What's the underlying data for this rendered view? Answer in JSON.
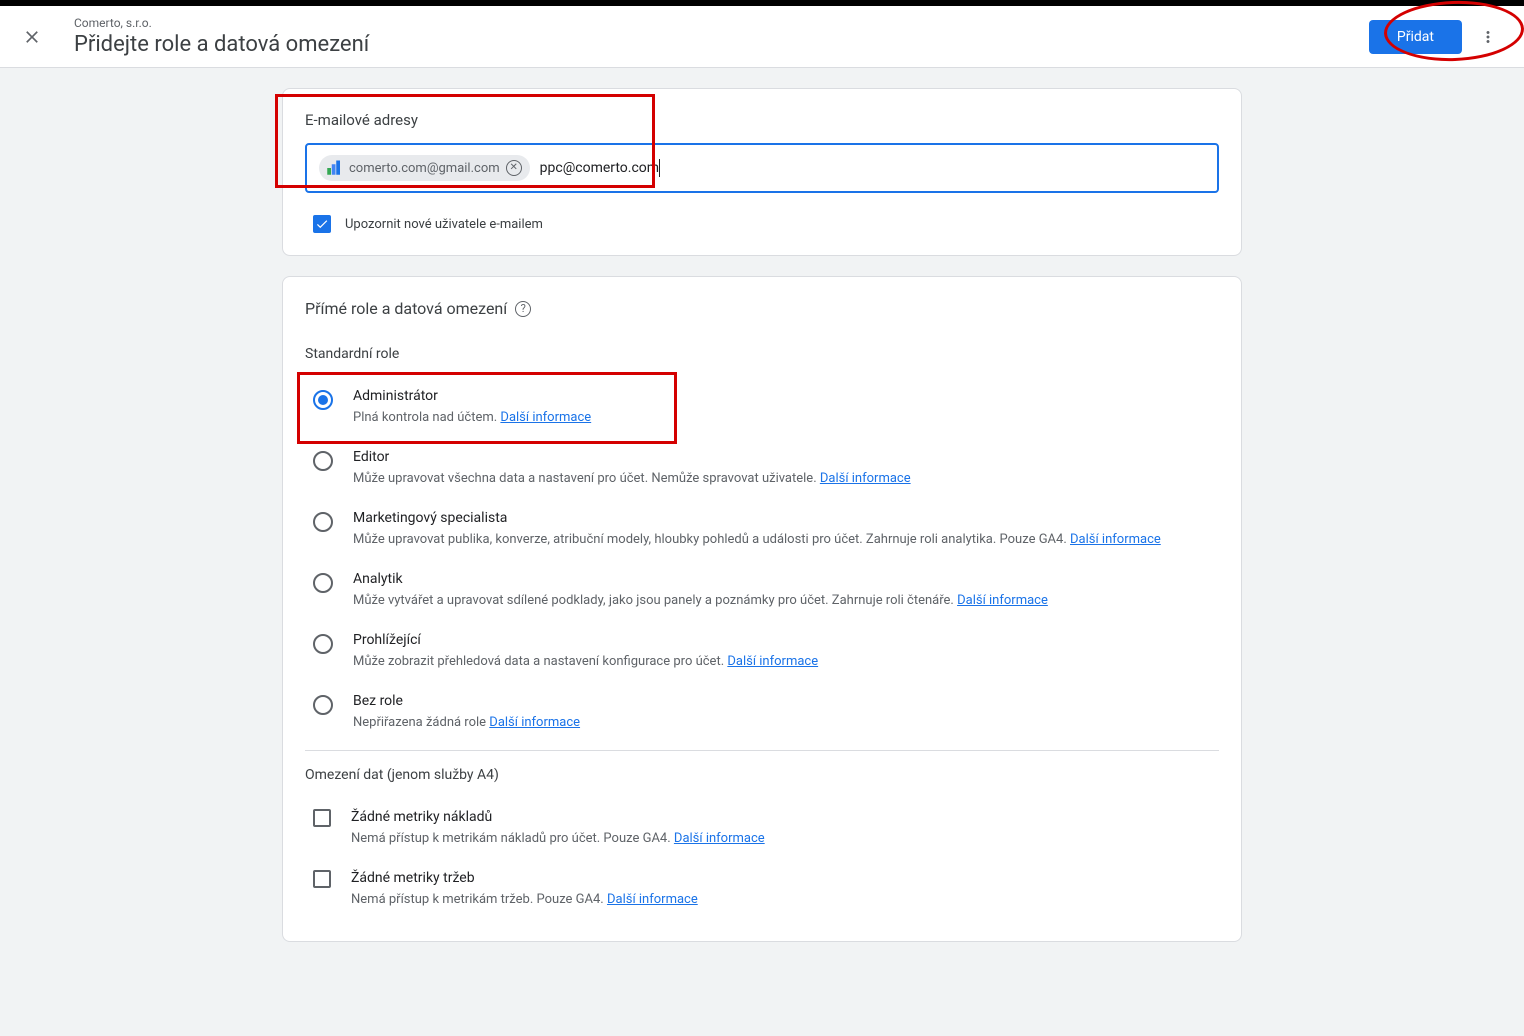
{
  "header": {
    "subtitle": "Comerto, s.r.o.",
    "title": "Přidejte role a datová omezení",
    "add_button": "Přidat"
  },
  "email_section": {
    "label": "E-mailové adresy",
    "chip_email": "comerto.com@gmail.com",
    "input_value": "ppc@comerto.com",
    "notify_label": "Upozornit nové uživatele e-mailem"
  },
  "roles_section": {
    "header": "Přímé role a datová omezení",
    "standard_label": "Standardní role",
    "more_info": "Další informace",
    "roles": [
      {
        "title": "Administrátor",
        "desc": "Plná kontrola nad účtem. ",
        "selected": true
      },
      {
        "title": "Editor",
        "desc": "Může upravovat všechna data a nastavení pro účet. Nemůže spravovat uživatele. ",
        "selected": false
      },
      {
        "title": "Marketingový specialista",
        "desc": "Může upravovat publika, konverze, atribuční modely, hloubky pohledů a události pro účet. Zahrnuje roli analytika. Pouze GA4. ",
        "selected": false
      },
      {
        "title": "Analytik",
        "desc": "Může vytvářet a upravovat sdílené podklady, jako jsou panely a poznámky pro účet. Zahrnuje roli čtenáře. ",
        "selected": false
      },
      {
        "title": "Prohlížející",
        "desc": "Může zobrazit přehledová data a nastavení konfigurace pro účet. ",
        "selected": false
      },
      {
        "title": "Bez role",
        "desc": "Nepřiřazena žádná role ",
        "selected": false
      }
    ],
    "restrictions_label": "Omezení dat (jenom služby A4)",
    "restrictions": [
      {
        "title": "Žádné metriky nákladů",
        "desc": "Nemá přístup k metrikám nákladů pro účet. Pouze GA4. "
      },
      {
        "title": "Žádné metriky tržeb",
        "desc": "Nemá přístup k metrikám tržeb. Pouze GA4. "
      }
    ]
  }
}
